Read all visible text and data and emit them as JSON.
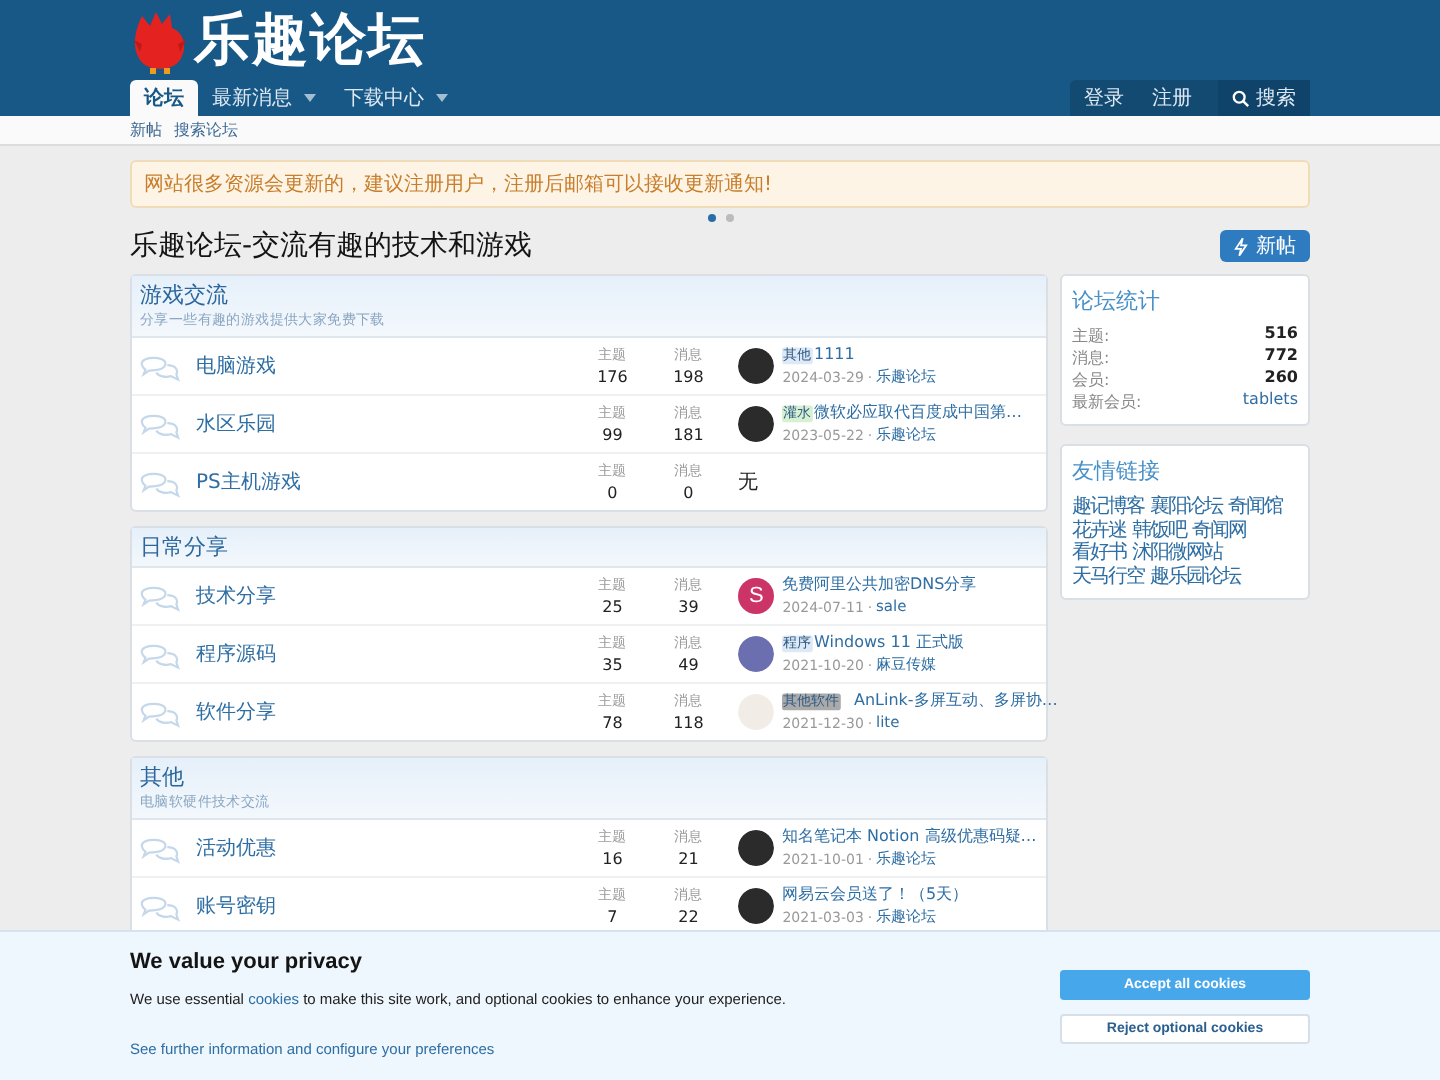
{
  "header": {
    "logo_text": "乐趣论坛"
  },
  "nav": {
    "tabs": [
      {
        "label": "论坛",
        "selected": true,
        "dropdown": false
      },
      {
        "label": "最新消息",
        "selected": false,
        "dropdown": true
      },
      {
        "label": "下载中心",
        "selected": false,
        "dropdown": true
      }
    ],
    "actions": [
      {
        "label": "登录",
        "kind": "text"
      },
      {
        "label": "注册",
        "kind": "text"
      },
      {
        "label": "搜索",
        "kind": "search"
      }
    ]
  },
  "subnav": [
    "新帖",
    "搜索论坛"
  ],
  "notice": {
    "text": "网站很多资源会更新的，建议注册用户，注册后邮箱可以接收更新通知!",
    "slides": [
      {
        "selected": true
      },
      {
        "selected": false
      }
    ]
  },
  "page_title": "乐趣论坛-交流有趣的技术和游戏",
  "new_post_button": "新帖",
  "categories": [
    {
      "title": "游戏交流",
      "description": "分享一些有趣的游戏提供大家免费下载",
      "forums": [
        {
          "name": "电脑游戏",
          "topics_label": "主题",
          "topics": "176",
          "messages_label": "消息",
          "messages": "198",
          "last_post": {
            "avatar": {
              "kind": "photo",
              "color": "#2b2b2b"
            },
            "prefix": {
              "label": "其他",
              "color": "#dde9f6"
            },
            "title": "1111",
            "separator": "·",
            "date": "2024-03-29",
            "author": "乐趣论坛"
          }
        },
        {
          "name": "水区乐园",
          "topics_label": "主题",
          "topics": "99",
          "messages_label": "消息",
          "messages": "181",
          "last_post": {
            "avatar": {
              "kind": "photo",
              "color": "#2b2b2b"
            },
            "prefix": {
              "label": "灌水",
              "color": "#d6f0d2"
            },
            "title": "微软必应取代百度成中国第…",
            "separator": "·",
            "date": "2023-05-22",
            "author": "乐趣论坛"
          }
        },
        {
          "name": "PS主机游戏",
          "topics_label": "主题",
          "topics": "0",
          "messages_label": "消息",
          "messages": "0",
          "empty_text": "无"
        }
      ]
    },
    {
      "title": "日常分享",
      "forums": [
        {
          "name": "技术分享",
          "topics_label": "主题",
          "topics": "25",
          "messages_label": "消息",
          "messages": "39",
          "last_post": {
            "avatar": {
              "kind": "letter",
              "letter": "S",
              "color": "#cc3366"
            },
            "title": "免费阿里公共加密DNS分享",
            "separator": "·",
            "date": "2024-07-11",
            "author": "sale"
          }
        },
        {
          "name": "程序源码",
          "topics_label": "主题",
          "topics": "35",
          "messages_label": "消息",
          "messages": "49",
          "last_post": {
            "avatar": {
              "kind": "photo",
              "color": "#6b6fb0"
            },
            "prefix": {
              "label": "程序",
              "color": "#dde9f6"
            },
            "title": "Windows 11 正式版",
            "separator": "·",
            "date": "2021-10-20",
            "author": "麻豆传媒"
          }
        },
        {
          "name": "软件分享",
          "topics_label": "主题",
          "topics": "78",
          "messages_label": "消息",
          "messages": "118",
          "last_post": {
            "avatar": {
              "kind": "photo",
              "color": "#f2ece6"
            },
            "prefix": {
              "label": "其他软件",
              "color": "#aaaaaa"
            },
            "title": "AnLink-多屏互动、多屏协…",
            "separator": "·",
            "date": "2021-12-30",
            "author": "lite"
          }
        }
      ]
    },
    {
      "title": "其他",
      "description": "电脑软硬件技术交流",
      "forums": [
        {
          "name": "活动优惠",
          "topics_label": "主题",
          "topics": "16",
          "messages_label": "消息",
          "messages": "21",
          "last_post": {
            "avatar": {
              "kind": "photo",
              "color": "#2b2b2b"
            },
            "title": "知名笔记本 Notion 高级优惠码疑…",
            "separator": "·",
            "date": "2021-10-01",
            "author": "乐趣论坛"
          }
        },
        {
          "name": "账号密钥",
          "topics_label": "主题",
          "topics": "7",
          "messages_label": "消息",
          "messages": "22",
          "last_post": {
            "avatar": {
              "kind": "photo",
              "color": "#2b2b2b"
            },
            "title": "网易云会员送了！（5天）",
            "separator": "·",
            "date": "2021-03-03",
            "author": "乐趣论坛"
          }
        }
      ]
    }
  ],
  "sidebar": {
    "stats": {
      "title": "论坛统计",
      "rows": [
        {
          "label": "主题:",
          "value": "516",
          "kind": "plain"
        },
        {
          "label": "消息:",
          "value": "772",
          "kind": "plain"
        },
        {
          "label": "会员:",
          "value": "260",
          "kind": "plain"
        },
        {
          "label": "最新会员:",
          "value": "tablets",
          "kind": "link"
        }
      ]
    },
    "links": {
      "title": "友情链接",
      "items": [
        "趣记博客",
        "襄阳论坛",
        "奇闻馆",
        "花卉迷",
        "韩饭吧",
        "奇闻网",
        "看好书",
        "沭阳微网站",
        "天马行空",
        "趣乐园论坛"
      ]
    }
  },
  "cookie": {
    "title": "We value your privacy",
    "text_before": "We use essential ",
    "link": "cookies",
    "text_after": " to make this site work, and optional cookies to enhance your experience.",
    "more_link": "See further information and configure your preferences",
    "accept": "Accept all cookies",
    "reject": "Reject optional cookies"
  }
}
